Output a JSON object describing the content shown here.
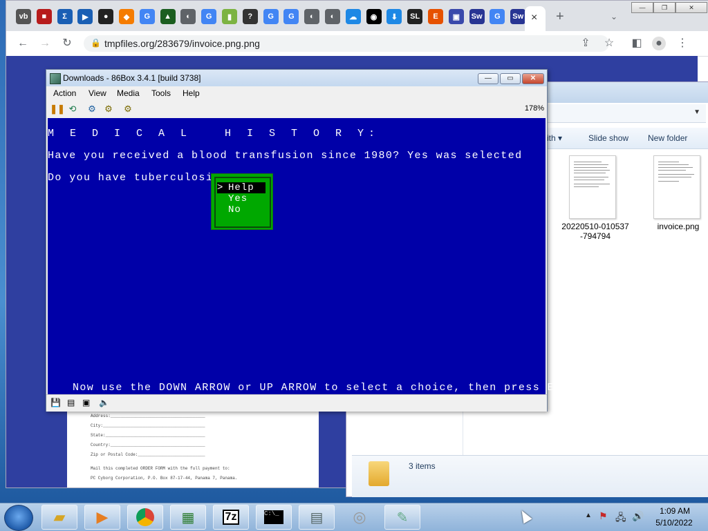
{
  "browser": {
    "url": "tmpfiles.org/283679/invoice.png.png",
    "new_tab_label": "+",
    "close_tab_label": "×",
    "tabs": [
      {
        "icon": "vb-icon",
        "color": "#555555"
      },
      {
        "icon": "red-square-icon",
        "color": "#b71c1c"
      },
      {
        "icon": "sigma-icon",
        "color": "#1a5fb4"
      },
      {
        "icon": "play-box-icon",
        "color": "#1a5fb4"
      },
      {
        "icon": "dark-circle-icon",
        "color": "#222222"
      },
      {
        "icon": "diamond-icon",
        "color": "#f57c00"
      },
      {
        "icon": "google-icon",
        "color": "#4285f4"
      },
      {
        "icon": "triangle-icon",
        "color": "#1b5e20"
      },
      {
        "icon": "globe-icon",
        "color": "#5f6368"
      },
      {
        "icon": "google-icon",
        "color": "#4285f4"
      },
      {
        "icon": "bars-icon",
        "color": "#7cb342"
      },
      {
        "icon": "help-icon",
        "color": "#333333"
      },
      {
        "icon": "google-icon",
        "color": "#4285f4"
      },
      {
        "icon": "google-icon",
        "color": "#4285f4"
      },
      {
        "icon": "globe-icon",
        "color": "#5f6368"
      },
      {
        "icon": "globe-icon",
        "color": "#5f6368"
      },
      {
        "icon": "cloud-icon",
        "color": "#1e88e5"
      },
      {
        "icon": "github-icon",
        "color": "#000000"
      },
      {
        "icon": "download-icon",
        "color": "#1e88e5"
      },
      {
        "icon": "sl-icon",
        "color": "#222222"
      },
      {
        "icon": "e-icon",
        "color": "#e65100"
      },
      {
        "icon": "floppy-icon",
        "color": "#3949ab"
      },
      {
        "icon": "sw-icon",
        "color": "#283593"
      },
      {
        "icon": "google-icon",
        "color": "#4285f4"
      },
      {
        "icon": "sw-icon",
        "color": "#283593"
      }
    ],
    "window_controls": {
      "minimize": "—",
      "restore": "❐",
      "close": "✕"
    }
  },
  "explorer": {
    "toolbar": {
      "share_with": "ith ▾",
      "slide_show": "Slide show",
      "new_folder": "New folder"
    },
    "files": [
      {
        "name_line1": "20220510-010537",
        "name_line2": "-794794"
      },
      {
        "name_line1": "invoice.png",
        "name_line2": ""
      }
    ],
    "status": "3 items"
  },
  "background_page": {
    "lines": [
      "Address:______________________________________",
      "City:_________________________________________",
      "State:________________________________________",
      "Country:______________________________________",
      "Zip or Postal Code:___________________________",
      "Mail this completed ORDER FORM with the full payment to:",
      "PC Cyborg Corporation, P.O. Box 87-17-44, Panama 7, Panama."
    ]
  },
  "emulator": {
    "title": "Downloads - 86Box 3.4.1 [build 3738]",
    "menu": [
      "Action",
      "View",
      "Media",
      "Tools",
      "Help"
    ],
    "zoom": "178%",
    "screen": {
      "heading": "M E D I C A L   H I S T O R Y:",
      "q1": "Have you received a blood transfusion since 1980? Yes was selected",
      "q2": "Do you have tuberculosis?",
      "options": [
        "Help",
        "Yes",
        "No"
      ],
      "selected_marker": ">",
      "footer": "Now use the DOWN ARROW or UP ARROW to select a choice, then press ENTER."
    }
  },
  "taskbar": {
    "clock_time": "1:09 AM",
    "clock_date": "5/10/2022"
  }
}
